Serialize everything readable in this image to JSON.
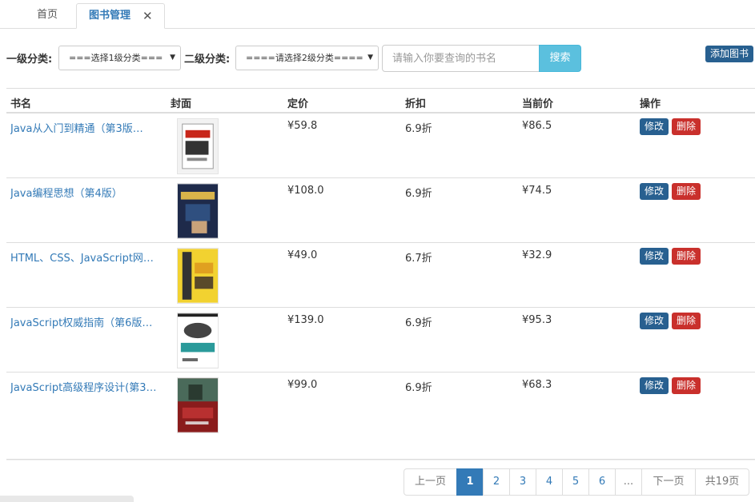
{
  "tabs": [
    {
      "label": "首页"
    },
    {
      "label": "图书管理",
      "close": "✕"
    }
  ],
  "filters": {
    "level1_label": "一级分类:",
    "level1_selected": "===选择1级分类===",
    "level2_label": "二级分类:",
    "level2_selected": "====请选择2级分类====",
    "search_placeholder": "请输入你要查询的书名",
    "search_button": "搜索",
    "add_button": "添加图书"
  },
  "table": {
    "headers": [
      "书名",
      "封面",
      "定价",
      "折扣",
      "当前价",
      "操作"
    ],
    "rows": [
      {
        "title": "Java从入门到精通（第3版…",
        "price": "¥59.8",
        "discount": "6.9折",
        "current": "¥86.5",
        "cover_icon": "book-cover-java-intro"
      },
      {
        "title": "Java编程思想（第4版）",
        "price": "¥108.0",
        "discount": "6.9折",
        "current": "¥74.5",
        "cover_icon": "book-cover-thinking-in-java"
      },
      {
        "title": "HTML、CSS、JavaScript网…",
        "price": "¥49.0",
        "discount": "6.7折",
        "current": "¥32.9",
        "cover_icon": "book-cover-html-css-js"
      },
      {
        "title": "JavaScript权威指南（第6版…",
        "price": "¥139.0",
        "discount": "6.9折",
        "current": "¥95.3",
        "cover_icon": "book-cover-js-definitive"
      },
      {
        "title": "JavaScript高级程序设计(第3…",
        "price": "¥99.0",
        "discount": "6.9折",
        "current": "¥68.3",
        "cover_icon": "book-cover-js-professional"
      }
    ],
    "edit_label": "修改",
    "delete_label": "删除"
  },
  "pagination": {
    "prev": "上一页",
    "pages": [
      "1",
      "2",
      "3",
      "4",
      "5",
      "6"
    ],
    "active_page": "1",
    "ellipsis": "...",
    "next": "下一页",
    "total": "共19页"
  },
  "colors": {
    "primary": "#337ab7",
    "info": "#5bc0de",
    "danger": "#c9302c",
    "dark_primary": "#286090"
  }
}
